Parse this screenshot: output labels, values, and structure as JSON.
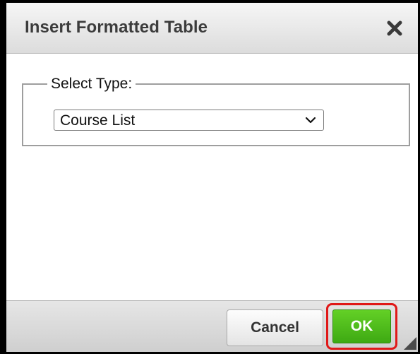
{
  "dialog": {
    "title": "Insert Formatted Table",
    "close_icon": "close-icon"
  },
  "form": {
    "legend": "Select Type:",
    "select": {
      "selected_value": "Course List",
      "chevron_icon": "chevron-down-icon"
    }
  },
  "footer": {
    "cancel_label": "Cancel",
    "ok_label": "OK",
    "highlight_color": "#e01818",
    "ok_color": "#4cbb17",
    "resize_icon": "resize-grip-icon"
  }
}
